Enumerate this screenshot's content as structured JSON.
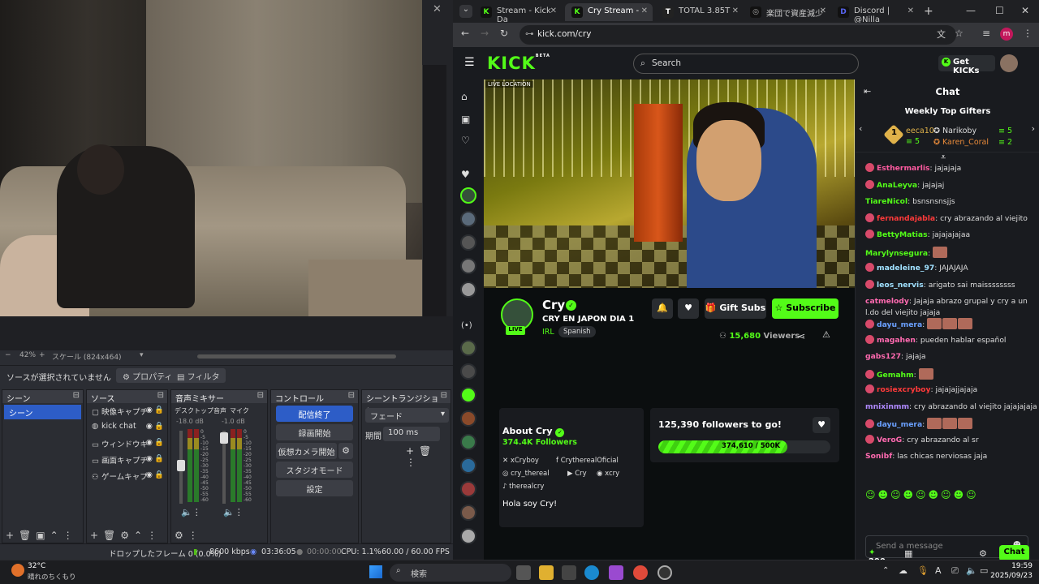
{
  "obs": {
    "zoom": "42%",
    "scale_label": "スケール (824x464)",
    "no_source": "ソースが選択されていません",
    "properties_btn": "プロパティ",
    "filter_btn": "フィルタ",
    "docks": {
      "scenes_title": "シーン",
      "sources_title": "ソース",
      "mixer_title": "音声ミキサー",
      "controls_title": "コントロール",
      "transition_title": "シーントランジション"
    },
    "scene_item": "シーン",
    "sources": [
      {
        "icon": "camera-icon",
        "label": "映像キャプチ"
      },
      {
        "icon": "browser-icon",
        "label": "kick chat"
      },
      {
        "icon": "window-icon",
        "label": "ウィンドウキ"
      },
      {
        "icon": "monitor-icon",
        "label": "画面キャプチ"
      },
      {
        "icon": "gamepad-icon",
        "label": "ゲームキャプ"
      }
    ],
    "mixer": [
      {
        "label": "デスクトップ音声",
        "db": "-18.0 dB"
      },
      {
        "label": "マイク",
        "db": "-1.0 dB"
      }
    ],
    "meter_ticks": [
      "0",
      "-5",
      "-10",
      "-15",
      "-20",
      "-25",
      "-30",
      "-35",
      "-40",
      "-45",
      "-50",
      "-55",
      "-60"
    ],
    "controls": [
      "配信終了",
      "録画開始",
      "仮想カメラ開始",
      "スタジオモード",
      "設定"
    ],
    "transition": {
      "type": "フェード",
      "duration_label": "期間",
      "duration": "100 ms"
    },
    "status": {
      "dropped": "ドロップしたフレーム 0 (0.0%)",
      "bitrate": "8600 kbps",
      "stream_time": "03:36:05",
      "rec_time": "00:00:00",
      "cpu": "CPU: 1.1%",
      "fps": "60.00 / 60.00 FPS"
    }
  },
  "browser": {
    "tabs": [
      {
        "label": "Stream - Kick Da",
        "fav": "K",
        "color": "#53fc18"
      },
      {
        "label": "Cry Stream - ",
        "fav": "K",
        "color": "#53fc18",
        "active": true
      },
      {
        "label": "TOTAL 3.85T",
        "fav": "T",
        "color": "#ffffff"
      },
      {
        "label": "楽団で資産減少",
        "fav": "◎",
        "color": "#aaaaaa"
      },
      {
        "label": "Discord | @Nilla",
        "fav": "D",
        "color": "#5865f2"
      }
    ],
    "url": "kick.com/cry",
    "profile_initial": "m"
  },
  "kick": {
    "logo": "KICK",
    "logo_beta": "BETA",
    "search_placeholder": "Search",
    "get_kicks": "Get KICKs",
    "video_tag": "LIVE LOCATION",
    "streamer": {
      "name": "Cry",
      "live": "LIVE",
      "title": "CRY EN JAPON DIA 1",
      "category": "IRL",
      "language": "Spanish",
      "viewers": "15,680",
      "viewers_label": "Viewers"
    },
    "buttons": {
      "gift_subs": "Gift Subs",
      "subscribe": "Subscribe"
    },
    "about": {
      "heading": "About Cry",
      "followers": "374.4K",
      "followers_label": "Followers",
      "socials": [
        {
          "icon": "x-icon",
          "label": "xCryboy"
        },
        {
          "icon": "facebook-icon",
          "label": "CrytherealOficial"
        },
        {
          "icon": "instagram-icon",
          "label": "cry_thereal"
        },
        {
          "icon": "youtube-icon",
          "label": "Cry"
        },
        {
          "icon": "discord-icon",
          "label": "xcry"
        },
        {
          "icon": "tiktok-icon",
          "label": "therealcry"
        }
      ],
      "bio": "Hola soy Cry!"
    },
    "goal": {
      "heading": "125,390 followers to go!",
      "progress": "374,610 / 500K",
      "fraction": 0.749
    },
    "chat": {
      "title": "Chat",
      "gifters_title": "Weekly Top Gifters",
      "gifters": [
        {
          "name": "eeca10",
          "count": "5",
          "rank": "1",
          "color": "#e0b24a"
        },
        {
          "name": "Narikoby",
          "count": "5",
          "color": "#dddddd"
        },
        {
          "name": "Karen_Coral",
          "count": "2",
          "color": "#e88a3a"
        }
      ],
      "messages": [
        {
          "user": "Esthermarlis",
          "color": "#ff5aa0",
          "text": ": jajajaja"
        },
        {
          "user": "AnaLeyva",
          "color": "#53fc18",
          "text": ": jajajaj"
        },
        {
          "user": "TiareNicol",
          "color": "#53fc18",
          "text": ": bsnsnsnsjjs"
        },
        {
          "user": "fernandajabla",
          "color": "#ff3a3a",
          "text": ": cry abrazando al viejito"
        },
        {
          "user": "BettyMatias",
          "color": "#53fc18",
          "text": ": jajajajajaa"
        },
        {
          "user": "Marylynsegura",
          "color": "#53fc18",
          "text": ":"
        },
        {
          "user": "madeleine_97",
          "color": "#a0e0ff",
          "text": ": JAJAJAJA"
        },
        {
          "user": "leos_nervis",
          "color": "#a0e0ff",
          "text": ": arigato sai maissssssss"
        },
        {
          "user": "catmelody",
          "color": "#ff6ab0",
          "text": ": Jajaja abrazo grupal y cry a un l.do del viejito jajaja"
        },
        {
          "user": "dayu_mera",
          "color": "#6aa0ff",
          "text": ":"
        },
        {
          "user": "magahen",
          "color": "#ff6ab0",
          "text": ": pueden hablar español"
        },
        {
          "user": "gabs127",
          "color": "#ff6ab0",
          "text": ": jajaja"
        },
        {
          "user": "Gemahm",
          "color": "#53fc18",
          "text": ":"
        },
        {
          "user": "rosiexcryboy",
          "color": "#ff3a3a",
          "text": ": jajajajjajaja"
        },
        {
          "user": "mnixinmm",
          "color": "#b08aff",
          "text": ": cry abrazando al viejito jajajajaja"
        },
        {
          "user": "dayu_mera",
          "color": "#6aa0ff",
          "text": ":"
        },
        {
          "user": "VeroG",
          "color": "#ff6ab0",
          "text": ": cry abrazando al sr"
        },
        {
          "user": "Sonibf",
          "color": "#ff6ab0",
          "text": ": las chicas nerviosas jaja"
        }
      ],
      "input_placeholder": "Send a message",
      "kicks": "290",
      "send_label": "Chat"
    }
  },
  "taskbar": {
    "temp": "32°C",
    "weather": "晴れのちくもり",
    "search": "検索",
    "time": "19:59",
    "date": "2025/09/23",
    "ime": "A"
  }
}
